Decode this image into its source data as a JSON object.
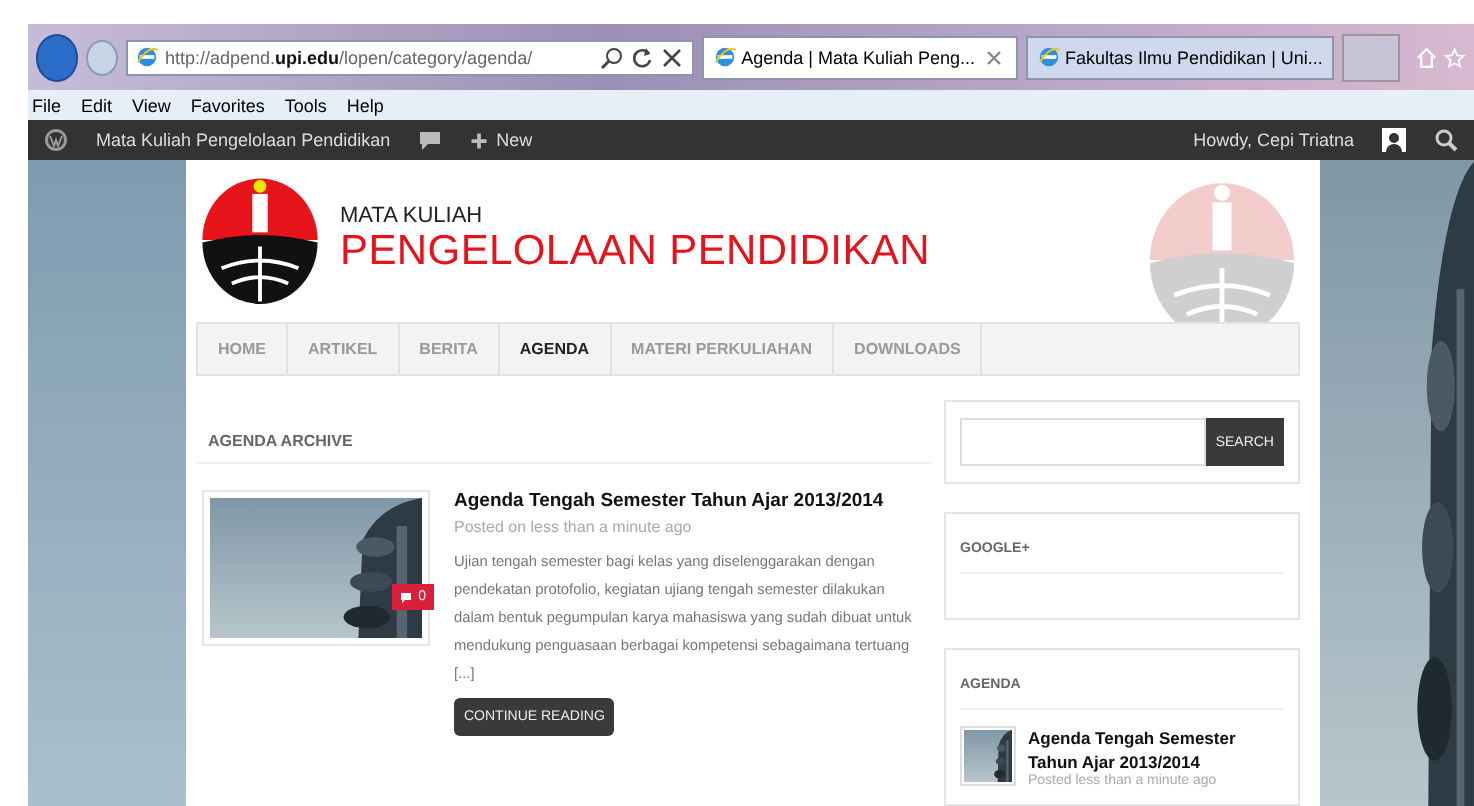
{
  "browser": {
    "address": {
      "host_prefix": "http://adpend.",
      "host_bold": "upi.edu",
      "path": "/lopen/category/agenda/"
    },
    "tabs": [
      {
        "label": "Agenda | Mata Kuliah Peng...",
        "selected": true,
        "closable": true
      },
      {
        "label": "Fakultas Ilmu Pendidikan | Uni...",
        "selected": false,
        "closable": false
      }
    ],
    "menu": [
      "File",
      "Edit",
      "View",
      "Favorites",
      "Tools",
      "Help"
    ]
  },
  "admin_bar": {
    "site": "Mata Kuliah Pengelolaan Pendidikan",
    "new": "New",
    "howdy": "Howdy, Cepi Triatna"
  },
  "header": {
    "subtitle": "MATA KULIAH",
    "title": "PENGELOLAAN PENDIDIKAN"
  },
  "nav": [
    {
      "label": "HOME",
      "selected": false
    },
    {
      "label": "ARTIKEL",
      "selected": false
    },
    {
      "label": "BERITA",
      "selected": false
    },
    {
      "label": "AGENDA",
      "selected": true
    },
    {
      "label": "MATERI PERKULIAHAN",
      "selected": false
    },
    {
      "label": "DOWNLOADS",
      "selected": false
    }
  ],
  "archive": {
    "heading": "AGENDA ARCHIVE",
    "posts": [
      {
        "title": "Agenda Tengah Semester Tahun Ajar 2013/2014",
        "meta": "Posted on less than a minute ago",
        "comments": "0",
        "excerpt": "Ujian tengah semester bagi kelas yang diselenggarakan dengan pendekatan protofolio, kegiatan ujiang tengah semester dilakukan dalam bentuk pegumpulan karya mahasiswa yang sudah dibuat untuk mendukung penguasaan berbagai kompetensi sebagaimana tertuang [...]",
        "button": "CONTINUE READING"
      }
    ]
  },
  "sidebar": {
    "search_button": "SEARCH",
    "widgets": [
      {
        "title": "GOOGLE+"
      },
      {
        "title": "AGENDA",
        "items": [
          {
            "title": "Agenda Tengah Semester Tahun Ajar 2013/2014",
            "meta": "Posted less than a minute ago"
          }
        ]
      }
    ]
  }
}
